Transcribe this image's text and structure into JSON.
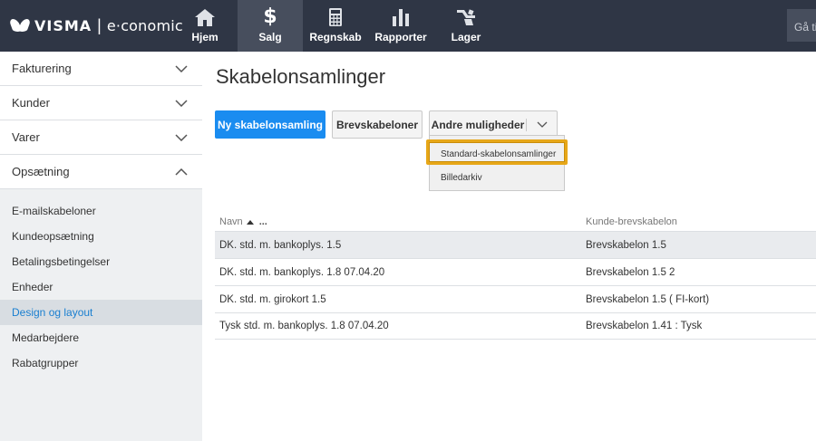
{
  "brand": {
    "name": "VISMA",
    "product": "e·conomic"
  },
  "nav": [
    {
      "label": "Hjem",
      "icon": "home-icon"
    },
    {
      "label": "Salg",
      "icon": "dollar-icon"
    },
    {
      "label": "Regnskab",
      "icon": "calculator-icon"
    },
    {
      "label": "Rapporter",
      "icon": "bar-chart-icon"
    },
    {
      "label": "Lager",
      "icon": "forklift-icon"
    }
  ],
  "search": {
    "label": "Gå ti"
  },
  "sidebar": {
    "sections": [
      {
        "label": "Fakturering",
        "state": "collapsed"
      },
      {
        "label": "Kunder",
        "state": "collapsed"
      },
      {
        "label": "Varer",
        "state": "collapsed"
      },
      {
        "label": "Opsætning",
        "state": "expanded"
      }
    ],
    "sub_items": [
      {
        "label": "E-mailskabeloner"
      },
      {
        "label": "Kundeopsætning"
      },
      {
        "label": "Betalingsbetingelser"
      },
      {
        "label": "Enheder"
      },
      {
        "label": "Design og layout",
        "active": true
      },
      {
        "label": "Medarbejdere"
      },
      {
        "label": "Rabatgrupper"
      }
    ]
  },
  "main": {
    "title": "Skabelonsamlinger",
    "buttons": {
      "primary": "Ny skabelonsamling",
      "secondary": "Brevskabeloner",
      "more": "Andre muligheder"
    },
    "dropdown": {
      "items": [
        "Standard-skabelonsamlinger",
        "Billedarkiv"
      ],
      "highlighted": "Standard-skabelonsamlinger"
    },
    "table": {
      "headers": {
        "name": "Navn",
        "name_extra": "...",
        "template": "Kunde-brevskabelon"
      },
      "rows": [
        {
          "name": "DK. std. m. bankoplys. 1.5",
          "template": "Brevskabelon 1.5"
        },
        {
          "name": "DK. std. m. bankoplys. 1.8 07.04.20",
          "template": "Brevskabelon 1.5 2"
        },
        {
          "name": "DK. std. m. girokort 1.5",
          "template": "Brevskabelon 1.5 ( FI-kort)"
        },
        {
          "name": "Tysk std. m. bankoplys. 1.8 07.04.20",
          "template": "Brevskabelon 1.41 : Tysk"
        }
      ]
    }
  },
  "colors": {
    "topbar": "#2f3645",
    "primary": "#1a8cf0",
    "highlight": "#e7a718",
    "active_link": "#1a7fd0"
  }
}
